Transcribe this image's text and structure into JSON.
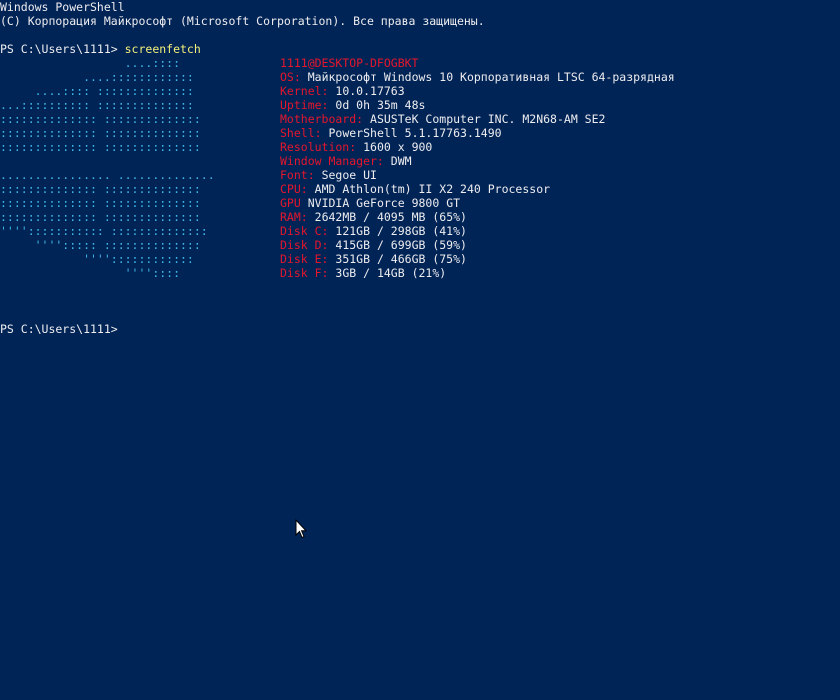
{
  "header": {
    "title": "Windows PowerShell",
    "copyright": "(C) Корпорация Майкрософт (Microsoft Corporation). Все права защищены."
  },
  "session": {
    "prompt1": "PS C:\\Users\\1111> ",
    "command": "screenfetch",
    "prompt2": "PS C:\\Users\\1111>"
  },
  "logo": [
    "                  ....::::",
    "            ....::::::::::::",
    "     ....:::: ::::::::::::::",
    "...:::::::::: ::::::::::::::",
    ":::::::::::::: ::::::::::::::",
    ":::::::::::::: ::::::::::::::",
    ":::::::::::::: ::::::::::::::",
    "................ ..............",
    ":::::::::::::: ::::::::::::::",
    ":::::::::::::: ::::::::::::::",
    ":::::::::::::: ::::::::::::::",
    "''''::::::::::: ::::::::::::::",
    "     ''''::::: ::::::::::::::",
    "            ''''::::::::::::",
    "                  ''''::::"
  ],
  "info": {
    "host": "1111@DESKTOP-DFOGBKT",
    "rows": [
      {
        "key": "OS:",
        "value": "Майкрософт Windows 10 Корпоративная LTSC 64-разрядная"
      },
      {
        "key": "Kernel:",
        "value": "10.0.17763"
      },
      {
        "key": "Uptime:",
        "value": "0d 0h 35m 48s"
      },
      {
        "key": "Motherboard:",
        "value": "ASUSTeK Computer INC. M2N68-AM SE2"
      },
      {
        "key": "Shell:",
        "value": "PowerShell 5.1.17763.1490"
      },
      {
        "key": "Resolution:",
        "value": "1600 x 900"
      },
      {
        "key": "Window Manager:",
        "value": "DWM"
      },
      {
        "key": "Font:",
        "value": "Segoe UI"
      },
      {
        "key": "CPU:",
        "value": "AMD Athlon(tm) II X2 240 Processor"
      },
      {
        "key": "GPU",
        "value": "NVIDIA GeForce 9800 GT"
      },
      {
        "key": "RAM:",
        "value": "2642MB / 4095 MB (65%)"
      },
      {
        "key": "Disk C:",
        "value": "121GB / 298GB (41%)"
      },
      {
        "key": "Disk D:",
        "value": "415GB / 699GB (59%)"
      },
      {
        "key": "Disk E:",
        "value": "351GB / 466GB (75%)"
      },
      {
        "key": "Disk F:",
        "value": "3GB / 14GB (21%)"
      }
    ]
  }
}
